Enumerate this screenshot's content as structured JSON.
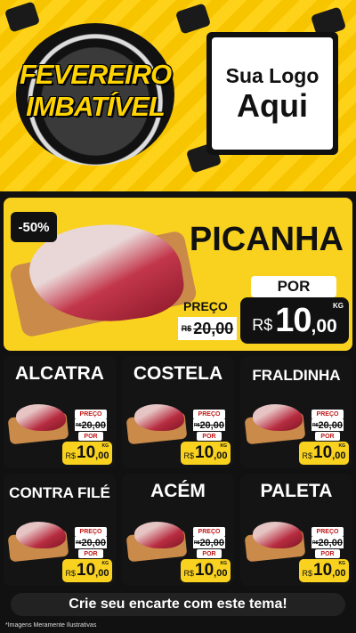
{
  "header": {
    "badge_line1": "FEVEREIRO",
    "badge_line2": "IMBATÍVEL",
    "logo_line1": "Sua Logo",
    "logo_line2": "Aqui"
  },
  "featured": {
    "discount": "-50%",
    "name": "PICANHA",
    "preco_label": "PREÇO",
    "old_currency": "R$",
    "old_price": "20,00",
    "por_label": "POR",
    "currency": "R$",
    "price_int": "10",
    "price_dec": ",00",
    "unit": "KG"
  },
  "products": [
    {
      "name": "ALCATRA",
      "preco_label": "PREÇO",
      "old_currency": "R$",
      "old_price": "20,00",
      "por_label": "POR",
      "currency": "R$",
      "price_int": "10",
      "price_dec": ",00",
      "unit": "KG"
    },
    {
      "name": "COSTELA",
      "preco_label": "PREÇO",
      "old_currency": "R$",
      "old_price": "20,00",
      "por_label": "POR",
      "currency": "R$",
      "price_int": "10",
      "price_dec": ",00",
      "unit": "KG"
    },
    {
      "name": "FRALDINHA",
      "preco_label": "PREÇO",
      "old_currency": "R$",
      "old_price": "20,00",
      "por_label": "POR",
      "currency": "R$",
      "price_int": "10",
      "price_dec": ",00",
      "unit": "KG"
    },
    {
      "name": "CONTRA FILÉ",
      "preco_label": "PREÇO",
      "old_currency": "R$",
      "old_price": "20,00",
      "por_label": "POR",
      "currency": "R$",
      "price_int": "10",
      "price_dec": ",00",
      "unit": "KG"
    },
    {
      "name": "ACÉM",
      "preco_label": "PREÇO",
      "old_currency": "R$",
      "old_price": "20,00",
      "por_label": "POR",
      "currency": "R$",
      "price_int": "10",
      "price_dec": ",00",
      "unit": "KG"
    },
    {
      "name": "PALETA",
      "preco_label": "PREÇO",
      "old_currency": "R$",
      "old_price": "20,00",
      "por_label": "POR",
      "currency": "R$",
      "price_int": "10",
      "price_dec": ",00",
      "unit": "KG"
    }
  ],
  "footer": {
    "cta": "Crie seu encarte com este tema!",
    "disclaimer": "*Imagens Meramente Ilustrativas"
  },
  "colors": {
    "yellow": "#f9d21f",
    "dark": "#111111",
    "strike_red": "#c01818"
  }
}
